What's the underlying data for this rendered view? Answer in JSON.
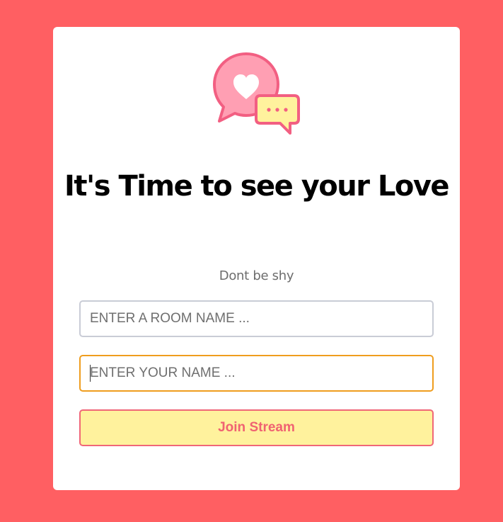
{
  "card": {
    "icon": "chat-heart-icon",
    "title": "It's Time to see your Love",
    "subtitle": "Dont be shy"
  },
  "form": {
    "room_placeholder": "ENTER A ROOM NAME ...",
    "room_value": "",
    "name_placeholder": "ENTER YOUR NAME ...",
    "name_value": "",
    "join_label": "Join Stream"
  },
  "colors": {
    "background": "#ff5f62",
    "card": "#ffffff",
    "accent_pink": "#f06778",
    "button_fill": "#fff29d",
    "focus_border": "#ef9d1e"
  }
}
